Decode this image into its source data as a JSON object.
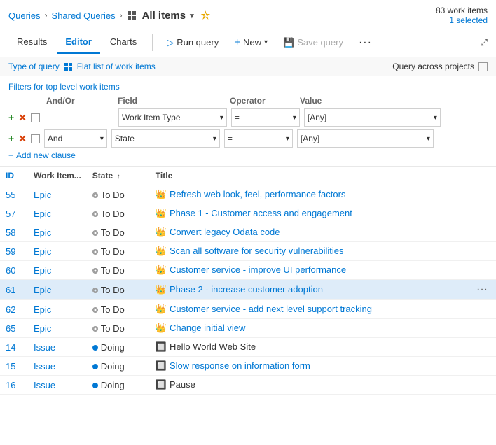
{
  "breadcrumb": {
    "items": [
      "Queries",
      "Shared Queries"
    ],
    "current": "All items",
    "work_items_count": "83 work items",
    "selected_text": "1 selected"
  },
  "tabs": [
    {
      "label": "Results",
      "active": false
    },
    {
      "label": "Editor",
      "active": true
    },
    {
      "label": "Charts",
      "active": false
    }
  ],
  "toolbar": {
    "run_query": "Run query",
    "new_label": "New",
    "save_query": "Save query"
  },
  "query_type": {
    "label": "Type of query",
    "type_value": "Flat list of work items",
    "query_across": "Query across projects"
  },
  "filters": {
    "top_label": "Filters for top level work items",
    "headers": {
      "and_or": "And/Or",
      "field": "Field",
      "operator": "Operator",
      "value": "Value"
    },
    "rows": [
      {
        "and_or": "",
        "field": "Work Item Type",
        "operator": "=",
        "value": "[Any]"
      },
      {
        "and_or": "And",
        "field": "State",
        "operator": "=",
        "value": "[Any]"
      }
    ],
    "add_clause": "Add new clause"
  },
  "table": {
    "columns": [
      "ID",
      "Work Item...",
      "State",
      "Title"
    ],
    "rows": [
      {
        "id": "55",
        "type": "Epic",
        "state": "To Do",
        "state_type": "todo",
        "title": "Refresh web look, feel, performance factors",
        "title_link": true,
        "selected": false,
        "more": false
      },
      {
        "id": "57",
        "type": "Epic",
        "state": "To Do",
        "state_type": "todo",
        "title": "Phase 1 - Customer access and engagement",
        "title_link": true,
        "selected": false,
        "more": false
      },
      {
        "id": "58",
        "type": "Epic",
        "state": "To Do",
        "state_type": "todo",
        "title": "Convert legacy Odata code",
        "title_link": true,
        "selected": false,
        "more": false
      },
      {
        "id": "59",
        "type": "Epic",
        "state": "To Do",
        "state_type": "todo",
        "title": "Scan all software for security vulnerabilities",
        "title_link": true,
        "selected": false,
        "more": false
      },
      {
        "id": "60",
        "type": "Epic",
        "state": "To Do",
        "state_type": "todo",
        "title": "Customer service - improve UI performance",
        "title_link": true,
        "selected": false,
        "more": false
      },
      {
        "id": "61",
        "type": "Epic",
        "state": "To Do",
        "state_type": "todo",
        "title": "Phase 2 - increase customer adoption",
        "title_link": true,
        "selected": true,
        "more": true
      },
      {
        "id": "62",
        "type": "Epic",
        "state": "To Do",
        "state_type": "todo",
        "title": "Customer service - add next level support tracking",
        "title_link": true,
        "selected": false,
        "more": false
      },
      {
        "id": "65",
        "type": "Epic",
        "state": "To Do",
        "state_type": "todo",
        "title": "Change initial view",
        "title_link": true,
        "selected": false,
        "more": false
      },
      {
        "id": "14",
        "type": "Issue",
        "state": "Doing",
        "state_type": "doing",
        "title": "Hello World Web Site",
        "title_link": false,
        "selected": false,
        "more": false
      },
      {
        "id": "15",
        "type": "Issue",
        "state": "Doing",
        "state_type": "doing",
        "title": "Slow response on information form",
        "title_link": true,
        "selected": false,
        "more": false
      },
      {
        "id": "16",
        "type": "Issue",
        "state": "Doing",
        "state_type": "doing",
        "title": "Pause",
        "title_link": false,
        "selected": false,
        "more": false
      }
    ]
  }
}
